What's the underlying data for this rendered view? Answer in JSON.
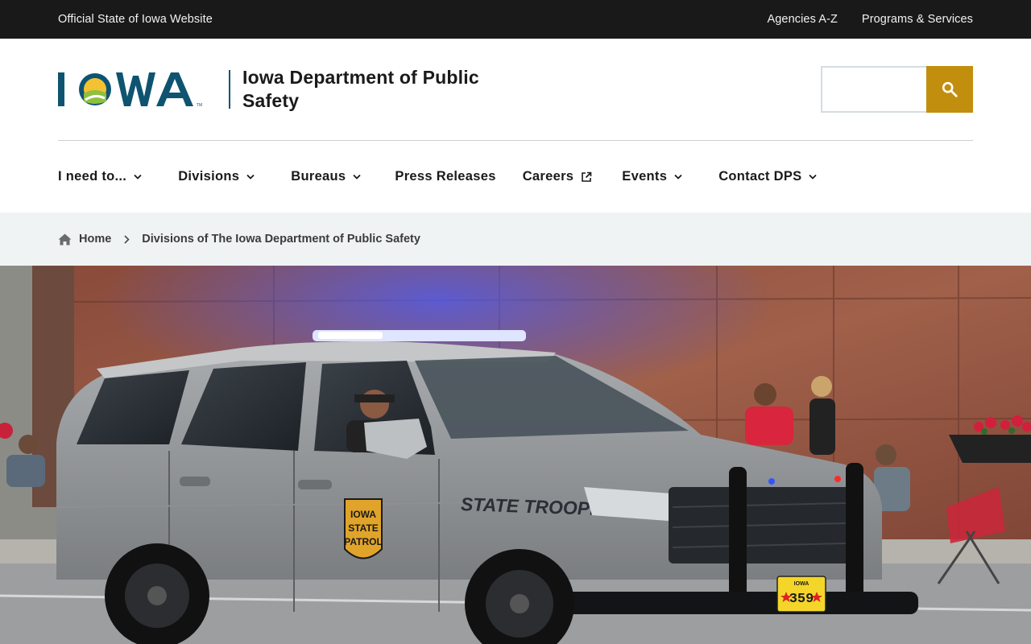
{
  "utility": {
    "official_label": "Official State of Iowa Website",
    "links": [
      "Agencies A-Z",
      "Programs & Services"
    ]
  },
  "header": {
    "logo_text": "IOWA",
    "agency_name": "Iowa Department of Public Safety",
    "search_placeholder": "",
    "search_icon": "search-icon"
  },
  "nav": {
    "items": [
      {
        "label": "I need to...",
        "icon": "chevron-down-icon"
      },
      {
        "label": "Divisions",
        "icon": "chevron-down-icon"
      },
      {
        "label": "Bureaus",
        "icon": "chevron-down-icon"
      },
      {
        "label": "Press Releases",
        "icon": ""
      },
      {
        "label": "Careers",
        "icon": "external-link-icon"
      },
      {
        "label": "Events",
        "icon": "chevron-down-icon"
      },
      {
        "label": "Contact DPS",
        "icon": "chevron-down-icon"
      }
    ]
  },
  "breadcrumb": {
    "home_label": "Home",
    "current_label": "Divisions of The Iowa Department of Public Safety"
  },
  "hero": {
    "vehicle_text": "STATE TROOPER",
    "badge_line1": "IOWA",
    "badge_line2": "STATE",
    "badge_line3": "PATROL",
    "plate_state": "IOWA",
    "plate_number": "359"
  },
  "colors": {
    "utility_bg": "#191919",
    "brand_teal": "#0e5470",
    "brand_gold": "#c28e0e",
    "breadcrumb_bg": "#f0f3f4"
  }
}
